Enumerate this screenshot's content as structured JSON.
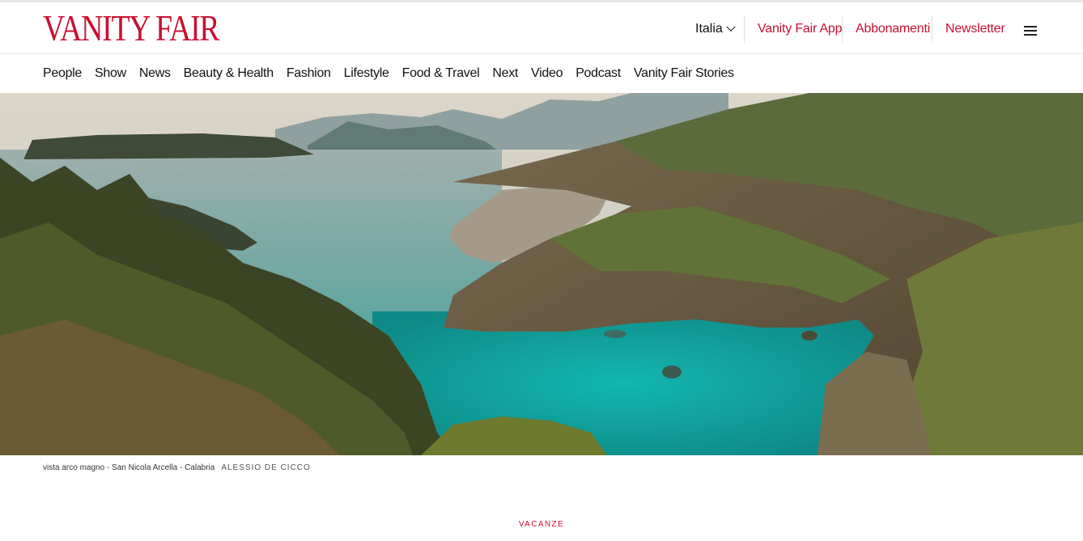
{
  "brand": {
    "logo_text": "VANITY FAIR",
    "accent_color": "#c8102e"
  },
  "header": {
    "edition": {
      "label": "Italia",
      "icon": "chevron-down-icon"
    },
    "links": [
      {
        "label": "Vanity Fair App"
      },
      {
        "label": "Abbonamenti"
      },
      {
        "label": "Newsletter"
      }
    ],
    "menu_icon": "hamburger-menu-icon"
  },
  "nav": {
    "items": [
      {
        "label": "People"
      },
      {
        "label": "Show"
      },
      {
        "label": "News"
      },
      {
        "label": "Beauty & Health"
      },
      {
        "label": "Fashion"
      },
      {
        "label": "Lifestyle"
      },
      {
        "label": "Food & Travel"
      },
      {
        "label": "Next"
      },
      {
        "label": "Video"
      },
      {
        "label": "Podcast"
      },
      {
        "label": "Vanity Fair Stories"
      }
    ]
  },
  "hero": {
    "caption": "vista arco magno - San Nicola Arcella - Calabria",
    "credit": "ALESSIO DE CICCO"
  },
  "article": {
    "kicker": "VACANZE"
  }
}
